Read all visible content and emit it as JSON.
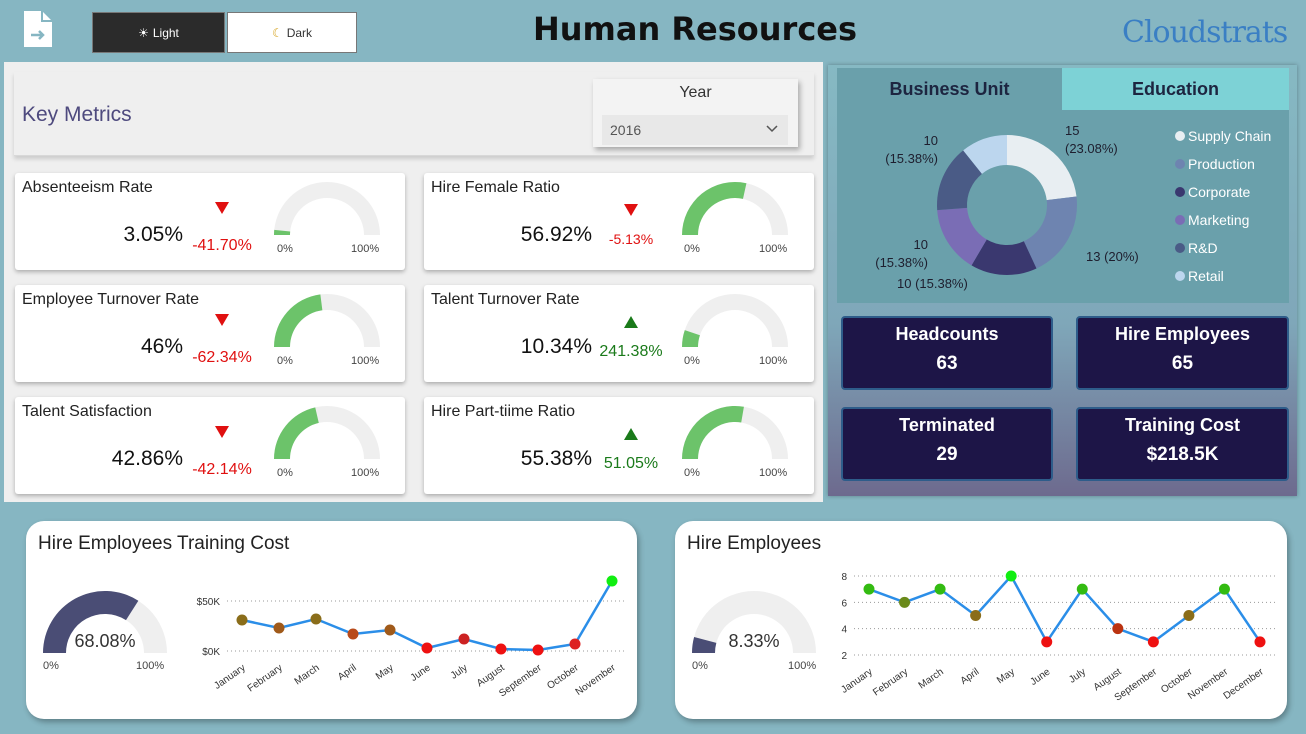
{
  "header": {
    "title": "Human Resources",
    "theme_light_label": "Light",
    "theme_dark_label": "Dark",
    "logo_text": "CloudStrats"
  },
  "metrics": {
    "title": "Key Metrics",
    "year_label": "Year",
    "year_value": "2016",
    "gauge_min": "0%",
    "gauge_max": "100%",
    "cards": [
      {
        "title": "Absenteeism Rate",
        "value": "3.05%",
        "change": "-41.70%",
        "trend": "down",
        "fill": 0.0305
      },
      {
        "title": "Hire Female Ratio",
        "value": "56.92%",
        "change": "-5.13%",
        "trend": "down",
        "fill": 0.5692
      },
      {
        "title": "Employee Turnover Rate",
        "value": "46%",
        "change": "-62.34%",
        "trend": "down",
        "fill": 0.46
      },
      {
        "title": "Talent Turnover Rate",
        "value": "10.34%",
        "change": "241.38%",
        "trend": "up",
        "fill": 0.1034
      },
      {
        "title": "Talent Satisfaction",
        "value": "42.86%",
        "change": "-42.14%",
        "trend": "down",
        "fill": 0.4286
      },
      {
        "title": "Hire Part-tiime Ratio",
        "value": "55.38%",
        "change": "51.05%",
        "trend": "up",
        "fill": 0.5538
      }
    ]
  },
  "breakdown": {
    "tabs": [
      "Business Unit",
      "Education"
    ],
    "legend": [
      {
        "name": "Supply Chain",
        "color": "#e8eef2"
      },
      {
        "name": "Production",
        "color": "#6e84b0"
      },
      {
        "name": "Corporate",
        "color": "#3a386f"
      },
      {
        "name": "Marketing",
        "color": "#7a6db5"
      },
      {
        "name": "R&D",
        "color": "#4a5b86"
      },
      {
        "name": "Retail",
        "color": "#bcd6ee"
      }
    ],
    "slice_labels": [
      "15",
      "(23.08%)",
      "13 (20%)",
      "10 (15.38%)",
      "10",
      "(15.38%)",
      "10",
      "(15.38%)"
    ]
  },
  "kpis": [
    {
      "title": "Headcounts",
      "value": "63"
    },
    {
      "title": "Hire Employees",
      "value": "65"
    },
    {
      "title": "Terminated",
      "value": "29"
    },
    {
      "title": "Training Cost",
      "value": "$218.5K"
    }
  ],
  "training_cost": {
    "title": "Hire Employees Training Cost",
    "gauge_value": "68.08%",
    "gauge_fill": 0.6808,
    "gauge_min": "0%",
    "gauge_max": "100%"
  },
  "hire_employees": {
    "title": "Hire Employees",
    "gauge_value": "8.33%",
    "gauge_fill": 0.0833,
    "gauge_min": "0%",
    "gauge_max": "100%"
  },
  "chart_data": [
    {
      "type": "pie",
      "categories": [
        "Supply Chain",
        "Production",
        "Corporate",
        "Marketing",
        "R&D",
        "Retail"
      ],
      "values": [
        15,
        13,
        10,
        10,
        10,
        7
      ]
    },
    {
      "type": "line",
      "categories": [
        "January",
        "February",
        "March",
        "April",
        "May",
        "June",
        "July",
        "August",
        "September",
        "October",
        "November"
      ],
      "values": [
        31,
        23,
        32,
        17,
        21,
        3,
        12,
        2,
        1,
        7,
        70
      ],
      "ylim": [
        0,
        70
      ],
      "yticks": [
        {
          "v": 0,
          "label": "$0K"
        },
        {
          "v": 50,
          "label": "$50K"
        }
      ],
      "colors": [
        "#8a6d1a",
        "#a05a1a",
        "#8a6d1a",
        "#b84a1a",
        "#a05a1a",
        "#ee1111",
        "#cc2222",
        "#ee1111",
        "#ee1111",
        "#dd2222",
        "#11ee11"
      ]
    },
    {
      "type": "line",
      "categories": [
        "January",
        "February",
        "March",
        "April",
        "May",
        "June",
        "July",
        "August",
        "September",
        "October",
        "November",
        "December"
      ],
      "values": [
        7,
        6,
        7,
        5,
        8,
        3,
        7,
        4,
        3,
        5,
        7,
        3
      ],
      "ylim": [
        2,
        8
      ],
      "yticks": [
        {
          "v": 2,
          "label": "2"
        },
        {
          "v": 4,
          "label": "4"
        },
        {
          "v": 6,
          "label": "6"
        },
        {
          "v": 8,
          "label": "8"
        }
      ],
      "colors": [
        "#33bb11",
        "#6a8a1a",
        "#33bb11",
        "#8a6d1a",
        "#11ee11",
        "#ee1111",
        "#33bb11",
        "#bb3311",
        "#ee1111",
        "#8a6d1a",
        "#33bb11",
        "#ee1111"
      ]
    }
  ]
}
